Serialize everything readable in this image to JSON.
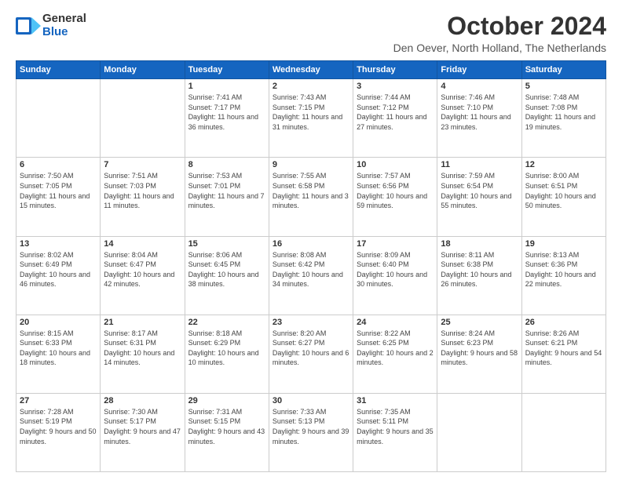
{
  "header": {
    "logo_general": "General",
    "logo_blue": "Blue",
    "month_title": "October 2024",
    "location": "Den Oever, North Holland, The Netherlands"
  },
  "weekdays": [
    "Sunday",
    "Monday",
    "Tuesday",
    "Wednesday",
    "Thursday",
    "Friday",
    "Saturday"
  ],
  "weeks": [
    [
      {
        "day": "",
        "sunrise": "",
        "sunset": "",
        "daylight": ""
      },
      {
        "day": "",
        "sunrise": "",
        "sunset": "",
        "daylight": ""
      },
      {
        "day": "1",
        "sunrise": "Sunrise: 7:41 AM",
        "sunset": "Sunset: 7:17 PM",
        "daylight": "Daylight: 11 hours and 36 minutes."
      },
      {
        "day": "2",
        "sunrise": "Sunrise: 7:43 AM",
        "sunset": "Sunset: 7:15 PM",
        "daylight": "Daylight: 11 hours and 31 minutes."
      },
      {
        "day": "3",
        "sunrise": "Sunrise: 7:44 AM",
        "sunset": "Sunset: 7:12 PM",
        "daylight": "Daylight: 11 hours and 27 minutes."
      },
      {
        "day": "4",
        "sunrise": "Sunrise: 7:46 AM",
        "sunset": "Sunset: 7:10 PM",
        "daylight": "Daylight: 11 hours and 23 minutes."
      },
      {
        "day": "5",
        "sunrise": "Sunrise: 7:48 AM",
        "sunset": "Sunset: 7:08 PM",
        "daylight": "Daylight: 11 hours and 19 minutes."
      }
    ],
    [
      {
        "day": "6",
        "sunrise": "Sunrise: 7:50 AM",
        "sunset": "Sunset: 7:05 PM",
        "daylight": "Daylight: 11 hours and 15 minutes."
      },
      {
        "day": "7",
        "sunrise": "Sunrise: 7:51 AM",
        "sunset": "Sunset: 7:03 PM",
        "daylight": "Daylight: 11 hours and 11 minutes."
      },
      {
        "day": "8",
        "sunrise": "Sunrise: 7:53 AM",
        "sunset": "Sunset: 7:01 PM",
        "daylight": "Daylight: 11 hours and 7 minutes."
      },
      {
        "day": "9",
        "sunrise": "Sunrise: 7:55 AM",
        "sunset": "Sunset: 6:58 PM",
        "daylight": "Daylight: 11 hours and 3 minutes."
      },
      {
        "day": "10",
        "sunrise": "Sunrise: 7:57 AM",
        "sunset": "Sunset: 6:56 PM",
        "daylight": "Daylight: 10 hours and 59 minutes."
      },
      {
        "day": "11",
        "sunrise": "Sunrise: 7:59 AM",
        "sunset": "Sunset: 6:54 PM",
        "daylight": "Daylight: 10 hours and 55 minutes."
      },
      {
        "day": "12",
        "sunrise": "Sunrise: 8:00 AM",
        "sunset": "Sunset: 6:51 PM",
        "daylight": "Daylight: 10 hours and 50 minutes."
      }
    ],
    [
      {
        "day": "13",
        "sunrise": "Sunrise: 8:02 AM",
        "sunset": "Sunset: 6:49 PM",
        "daylight": "Daylight: 10 hours and 46 minutes."
      },
      {
        "day": "14",
        "sunrise": "Sunrise: 8:04 AM",
        "sunset": "Sunset: 6:47 PM",
        "daylight": "Daylight: 10 hours and 42 minutes."
      },
      {
        "day": "15",
        "sunrise": "Sunrise: 8:06 AM",
        "sunset": "Sunset: 6:45 PM",
        "daylight": "Daylight: 10 hours and 38 minutes."
      },
      {
        "day": "16",
        "sunrise": "Sunrise: 8:08 AM",
        "sunset": "Sunset: 6:42 PM",
        "daylight": "Daylight: 10 hours and 34 minutes."
      },
      {
        "day": "17",
        "sunrise": "Sunrise: 8:09 AM",
        "sunset": "Sunset: 6:40 PM",
        "daylight": "Daylight: 10 hours and 30 minutes."
      },
      {
        "day": "18",
        "sunrise": "Sunrise: 8:11 AM",
        "sunset": "Sunset: 6:38 PM",
        "daylight": "Daylight: 10 hours and 26 minutes."
      },
      {
        "day": "19",
        "sunrise": "Sunrise: 8:13 AM",
        "sunset": "Sunset: 6:36 PM",
        "daylight": "Daylight: 10 hours and 22 minutes."
      }
    ],
    [
      {
        "day": "20",
        "sunrise": "Sunrise: 8:15 AM",
        "sunset": "Sunset: 6:33 PM",
        "daylight": "Daylight: 10 hours and 18 minutes."
      },
      {
        "day": "21",
        "sunrise": "Sunrise: 8:17 AM",
        "sunset": "Sunset: 6:31 PM",
        "daylight": "Daylight: 10 hours and 14 minutes."
      },
      {
        "day": "22",
        "sunrise": "Sunrise: 8:18 AM",
        "sunset": "Sunset: 6:29 PM",
        "daylight": "Daylight: 10 hours and 10 minutes."
      },
      {
        "day": "23",
        "sunrise": "Sunrise: 8:20 AM",
        "sunset": "Sunset: 6:27 PM",
        "daylight": "Daylight: 10 hours and 6 minutes."
      },
      {
        "day": "24",
        "sunrise": "Sunrise: 8:22 AM",
        "sunset": "Sunset: 6:25 PM",
        "daylight": "Daylight: 10 hours and 2 minutes."
      },
      {
        "day": "25",
        "sunrise": "Sunrise: 8:24 AM",
        "sunset": "Sunset: 6:23 PM",
        "daylight": "Daylight: 9 hours and 58 minutes."
      },
      {
        "day": "26",
        "sunrise": "Sunrise: 8:26 AM",
        "sunset": "Sunset: 6:21 PM",
        "daylight": "Daylight: 9 hours and 54 minutes."
      }
    ],
    [
      {
        "day": "27",
        "sunrise": "Sunrise: 7:28 AM",
        "sunset": "Sunset: 5:19 PM",
        "daylight": "Daylight: 9 hours and 50 minutes."
      },
      {
        "day": "28",
        "sunrise": "Sunrise: 7:30 AM",
        "sunset": "Sunset: 5:17 PM",
        "daylight": "Daylight: 9 hours and 47 minutes."
      },
      {
        "day": "29",
        "sunrise": "Sunrise: 7:31 AM",
        "sunset": "Sunset: 5:15 PM",
        "daylight": "Daylight: 9 hours and 43 minutes."
      },
      {
        "day": "30",
        "sunrise": "Sunrise: 7:33 AM",
        "sunset": "Sunset: 5:13 PM",
        "daylight": "Daylight: 9 hours and 39 minutes."
      },
      {
        "day": "31",
        "sunrise": "Sunrise: 7:35 AM",
        "sunset": "Sunset: 5:11 PM",
        "daylight": "Daylight: 9 hours and 35 minutes."
      },
      {
        "day": "",
        "sunrise": "",
        "sunset": "",
        "daylight": ""
      },
      {
        "day": "",
        "sunrise": "",
        "sunset": "",
        "daylight": ""
      }
    ]
  ]
}
